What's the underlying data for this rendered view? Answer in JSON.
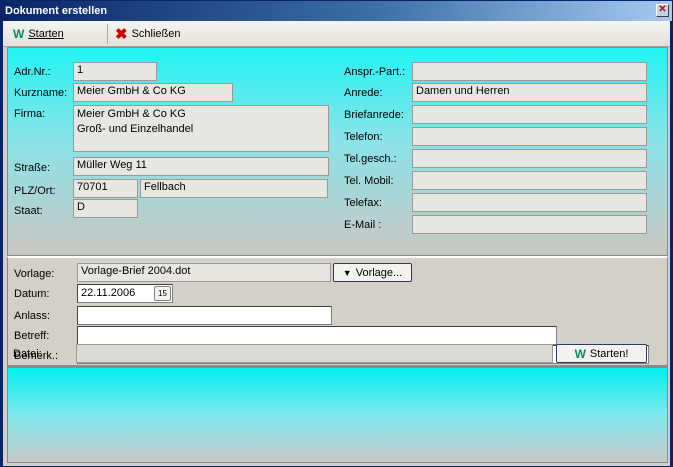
{
  "window": {
    "title": "Dokument erstellen",
    "close_glyph": "✕"
  },
  "toolbar": {
    "start_label": "Starten",
    "close_label": "Schließen"
  },
  "address": {
    "adr_nr_label": "Adr.Nr.:",
    "adr_nr": "1",
    "kurzname_label": "Kurzname:",
    "kurzname": "Meier GmbH & Co KG",
    "firma_label": "Firma:",
    "firma_line1": "Meier GmbH & Co KG",
    "firma_line2": "Groß- und Einzelhandel",
    "strasse_label": "Straße:",
    "strasse": "Müller Weg 11",
    "plz_ort_label": "PLZ/Ort:",
    "plz": "70701",
    "ort": "Fellbach",
    "staat_label": "Staat:",
    "staat": "D"
  },
  "contact": {
    "ansprechpartner_label": "Anspr.-Part.:",
    "ansprechpartner": "",
    "anrede_label": "Anrede:",
    "anrede": "Damen und Herren",
    "briefanrede_label": "Briefanrede:",
    "briefanrede": "",
    "telefon_label": "Telefon:",
    "telefon": "",
    "tel_gesch_label": "Tel.gesch.:",
    "tel_gesch": "",
    "tel_mobil_label": "Tel. Mobil:",
    "tel_mobil": "",
    "telefax_label": "Telefax:",
    "telefax": "",
    "email_label": "E-Mail :",
    "email": ""
  },
  "document": {
    "vorlage_label": "Vorlage:",
    "vorlage": "Vorlage-Brief 2004.dot",
    "vorlage_button": "Vorlage...",
    "datum_label": "Datum:",
    "datum": "22.11.2006",
    "calendar_glyph": "15",
    "anlass_label": "Anlass:",
    "anlass": "",
    "betreff_label": "Betreff:",
    "betreff": "",
    "bemerk_label": "Bemerk.:",
    "bemerk": "",
    "datei_label": "Datei:",
    "datei": "",
    "start_button": "Starten!"
  },
  "colors": {
    "title_bar": "#0a246a",
    "panel_cyan": "#22f3f3",
    "window_bg": "#d4d0c8"
  },
  "icons": [
    "start-icon",
    "close-x-icon",
    "dropdown-arrow-icon",
    "calendar-icon"
  ]
}
